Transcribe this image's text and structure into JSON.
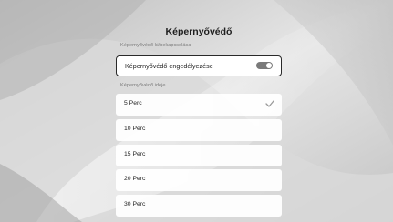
{
  "screen": {
    "title": "Képernyővédő"
  },
  "toggle_section": {
    "label": "Képernyővédő ki/bekapcsolása",
    "item_label": "Képernyővédő engedélyezése",
    "enabled": true
  },
  "time_section": {
    "label": "Képernyővédő ideje",
    "options": [
      {
        "label": "5 Perc",
        "selected": true
      },
      {
        "label": "10 Perc",
        "selected": false
      },
      {
        "label": "15 Perc",
        "selected": false
      },
      {
        "label": "20 Perc",
        "selected": false
      },
      {
        "label": "30 Perc",
        "selected": false
      }
    ]
  },
  "icons": {
    "toggle": "toggle-switch-icon",
    "selected": "checkmark-icon"
  },
  "colors": {
    "background": "#cfcfcf",
    "toggle_on": "#7a7a7a",
    "focus_border": "#2a2a2a",
    "checkmark": "#9a9a9a"
  }
}
